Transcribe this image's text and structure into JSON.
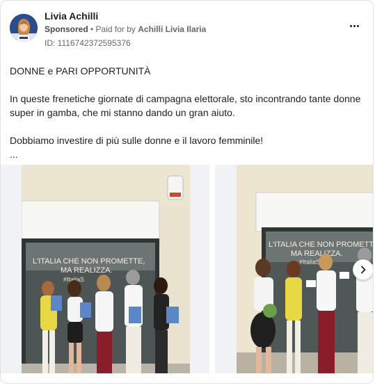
{
  "post": {
    "author": "Livia Achilli",
    "sponsored": "Sponsored",
    "separator": " • ",
    "paid_for": "Paid for by",
    "payer": "Achilli Livia Ilaria",
    "ad_id": "ID: 1116742372595376"
  },
  "text": {
    "line1": "DONNE e PARI OPPORTUNITÀ",
    "line2": "In queste frenetiche giornate di campagna elettorale, sto incontrando tante donne super in gamba, che mi stanno dando un gran aiuto.",
    "line3": "Dobbiamo investire di più sulle donne e il lavoro femminile!",
    "ellipsis": "..."
  },
  "images": {
    "window_text_line1": "L'ITALIA CHE NON PROMETTE,",
    "window_text_line2": "MA REALIZZA.",
    "window_hashtag_1": "#ItaliaS",
    "window_text2_line1": "L'ITALIA CHE NON PROMETTE,",
    "window_text2_line2": "MA REALIZZA.",
    "window_hashtag_2": "#ItaliaS    rio"
  },
  "icons": {
    "more": "more-horizontal-icon",
    "next": "chevron-right-icon"
  },
  "colors": {
    "text": "#1c1e21",
    "muted": "#65676b",
    "border": "#dfe1e5"
  }
}
